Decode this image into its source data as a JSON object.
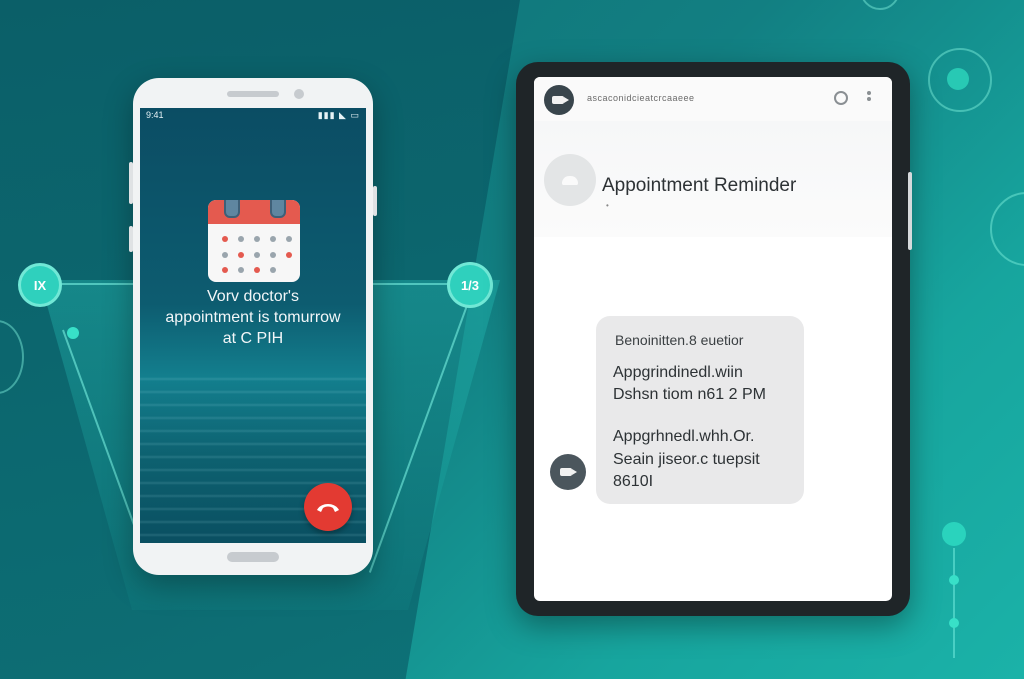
{
  "background": {
    "accent": "#1bb2a8",
    "left_icon_text": "IX",
    "right_icon_text": "1/3"
  },
  "phone": {
    "status_left": "9:41",
    "status_right": "▮▮▮ ◣ ▭",
    "notification": {
      "line1": "Vorv doctor's",
      "line2": "appointment is tomurrow",
      "line3": "at C PIH"
    },
    "decline_icon": "phone-hangup-icon",
    "decline_color": "#e33a32"
  },
  "tablet": {
    "header_text": "ascaconidcieatcrcaaeee",
    "contact_title": "Appointment Reminder",
    "contact_sub": "•",
    "message": {
      "heading": "Benoinitten.8 euetior",
      "line1": "Appgrindinedl.wiin",
      "line2": "Dshsn tiom n61 2 PM",
      "line3": "Appgrhnedl.whh.Or.",
      "line4": "Seain jiseor.c tuepsit",
      "line5": "8610I"
    }
  }
}
